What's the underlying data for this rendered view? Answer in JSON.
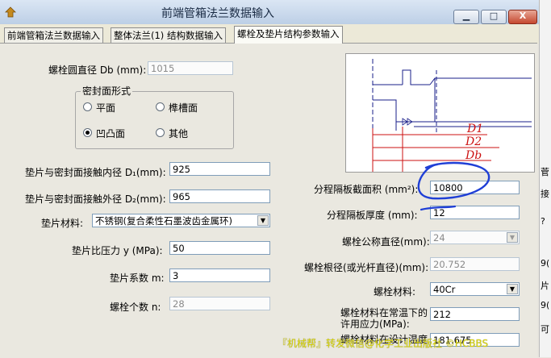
{
  "window": {
    "title": "前端管箱法兰数据输入",
    "buttons": {
      "minimize": "▁",
      "maximize": "□",
      "close": "X"
    }
  },
  "tabs": [
    {
      "label": "前端管箱法兰数据输入"
    },
    {
      "label": "整体法兰(1) 结构数据输入"
    },
    {
      "label": "螺栓及垫片结构参数输入"
    }
  ],
  "fields": {
    "bolt_circle_diameter": {
      "label": "螺栓圆直径 Db (mm):",
      "value": "1015"
    },
    "gasket_inner_diameter": {
      "label": "垫片与密封面接触内径 D₁(mm):",
      "value": "925"
    },
    "gasket_outer_diameter": {
      "label": "垫片与密封面接触外径 D₂(mm):",
      "value": "965"
    },
    "gasket_material": {
      "label": "垫片材料:",
      "value": "不锈钢(复合柔性石墨波齿金属环)"
    },
    "gasket_pressure": {
      "label": "垫片比压力 y (MPa):",
      "value": "50"
    },
    "gasket_coefficient": {
      "label": "垫片系数 m:",
      "value": "3"
    },
    "bolt_count": {
      "label": "螺栓个数 n:",
      "value": "28"
    },
    "partition_area": {
      "label": "分程隔板截面积 (mm²):",
      "value": "10800"
    },
    "partition_thickness": {
      "label": "分程隔板厚度 (mm):",
      "value": "12"
    },
    "bolt_nominal_diameter": {
      "label": "螺栓公称直径(mm):",
      "value": "24"
    },
    "bolt_root_diameter": {
      "label": "螺栓根径(或光杆直径)(mm):",
      "value": "20.752"
    },
    "bolt_material": {
      "label": "螺栓材料:",
      "value": "40Cr"
    },
    "bolt_allowable_stress_normal": {
      "label_line1": "螺栓材料在常温下的",
      "label_line2": "许用应力(MPa):",
      "value": "212"
    },
    "bolt_allowable_stress_design": {
      "label": "螺栓材料在设计温度",
      "value": "181.675"
    }
  },
  "seal_type": {
    "legend": "密封面形式",
    "options": [
      {
        "label": "平面",
        "selected": false
      },
      {
        "label": "榫槽面",
        "selected": false
      },
      {
        "label": "凹凸面",
        "selected": true
      },
      {
        "label": "其他",
        "selected": false
      }
    ]
  },
  "diagram": {
    "labels": [
      "D1",
      "D2",
      "Db"
    ]
  },
  "right_strip": {
    "chars": [
      "菅",
      "接",
      "?",
      "9(",
      "片",
      "9(",
      "可"
    ]
  },
  "watermark": "『机械帮』转发微信@化学工业出版社 ©HCBBS",
  "colors": {
    "annotation_blue": "#1f3fd6",
    "diagram_red": "#cc1111"
  }
}
